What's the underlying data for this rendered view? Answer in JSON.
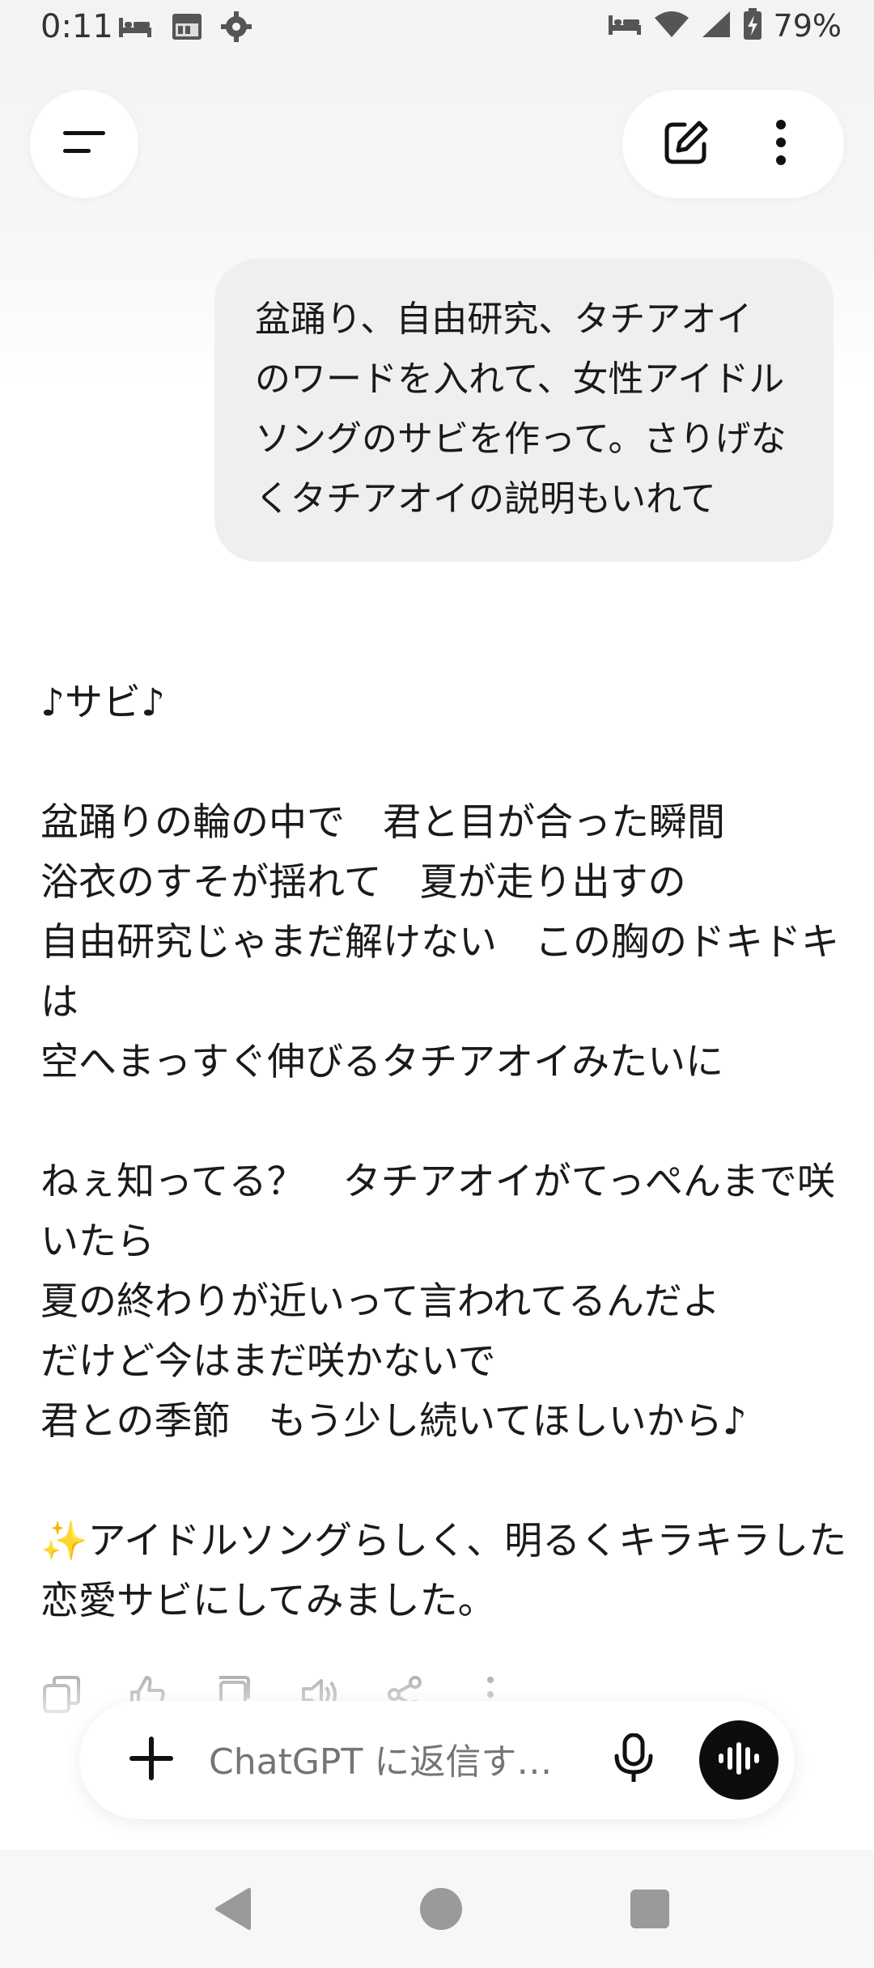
{
  "status_bar": {
    "time": "0:11",
    "battery_percent": "79%",
    "left_icons": [
      "bed-icon",
      "calendar-widget-icon",
      "gear-icon"
    ],
    "right_icons": [
      "bed-icon",
      "wifi-icon",
      "signal-icon",
      "battery-charging-icon"
    ]
  },
  "top_bar": {
    "menu_icon": "menu-icon",
    "new_chat_icon": "edit-icon",
    "more_icon": "more-vertical-icon"
  },
  "user_message": {
    "text": "盆踊り、自由研究、タチアオイ　のワードを入れて、女性アイドルソングのサビを作って。さりげなくタチアオイの説明もいれて"
  },
  "assistant_message": {
    "paragraphs": [
      "♪サビ♪",
      "盆踊りの輪の中で　君と目が合った瞬間\n浴衣のすそが揺れて　夏が走り出すの\n自由研究じゃまだ解けない　この胸のドキドキは\n空へまっすぐ伸びるタチアオイみたいに",
      "ねぇ知ってる？　タチアオイがてっぺんまで咲いたら\n夏の終わりが近いって言われてるんだよ\nだけど今はまだ咲かないで\n君との季節　もう少し続いてほしいから♪",
      "✨アイドルソングらしく、明るくキラキラした恋愛サビにしてみました。"
    ],
    "actions": [
      "copy-icon",
      "thumbs-up-icon",
      "thumbs-down-icon",
      "speaker-icon",
      "share-icon",
      "more-icon"
    ]
  },
  "composer": {
    "placeholder": "ChatGPT に返信す…",
    "plus_icon": "plus-icon",
    "mic_icon": "mic-icon",
    "voice_icon": "voice-mode-icon"
  },
  "nav_bar": {
    "buttons": [
      "back-icon",
      "home-icon",
      "recents-icon"
    ]
  }
}
